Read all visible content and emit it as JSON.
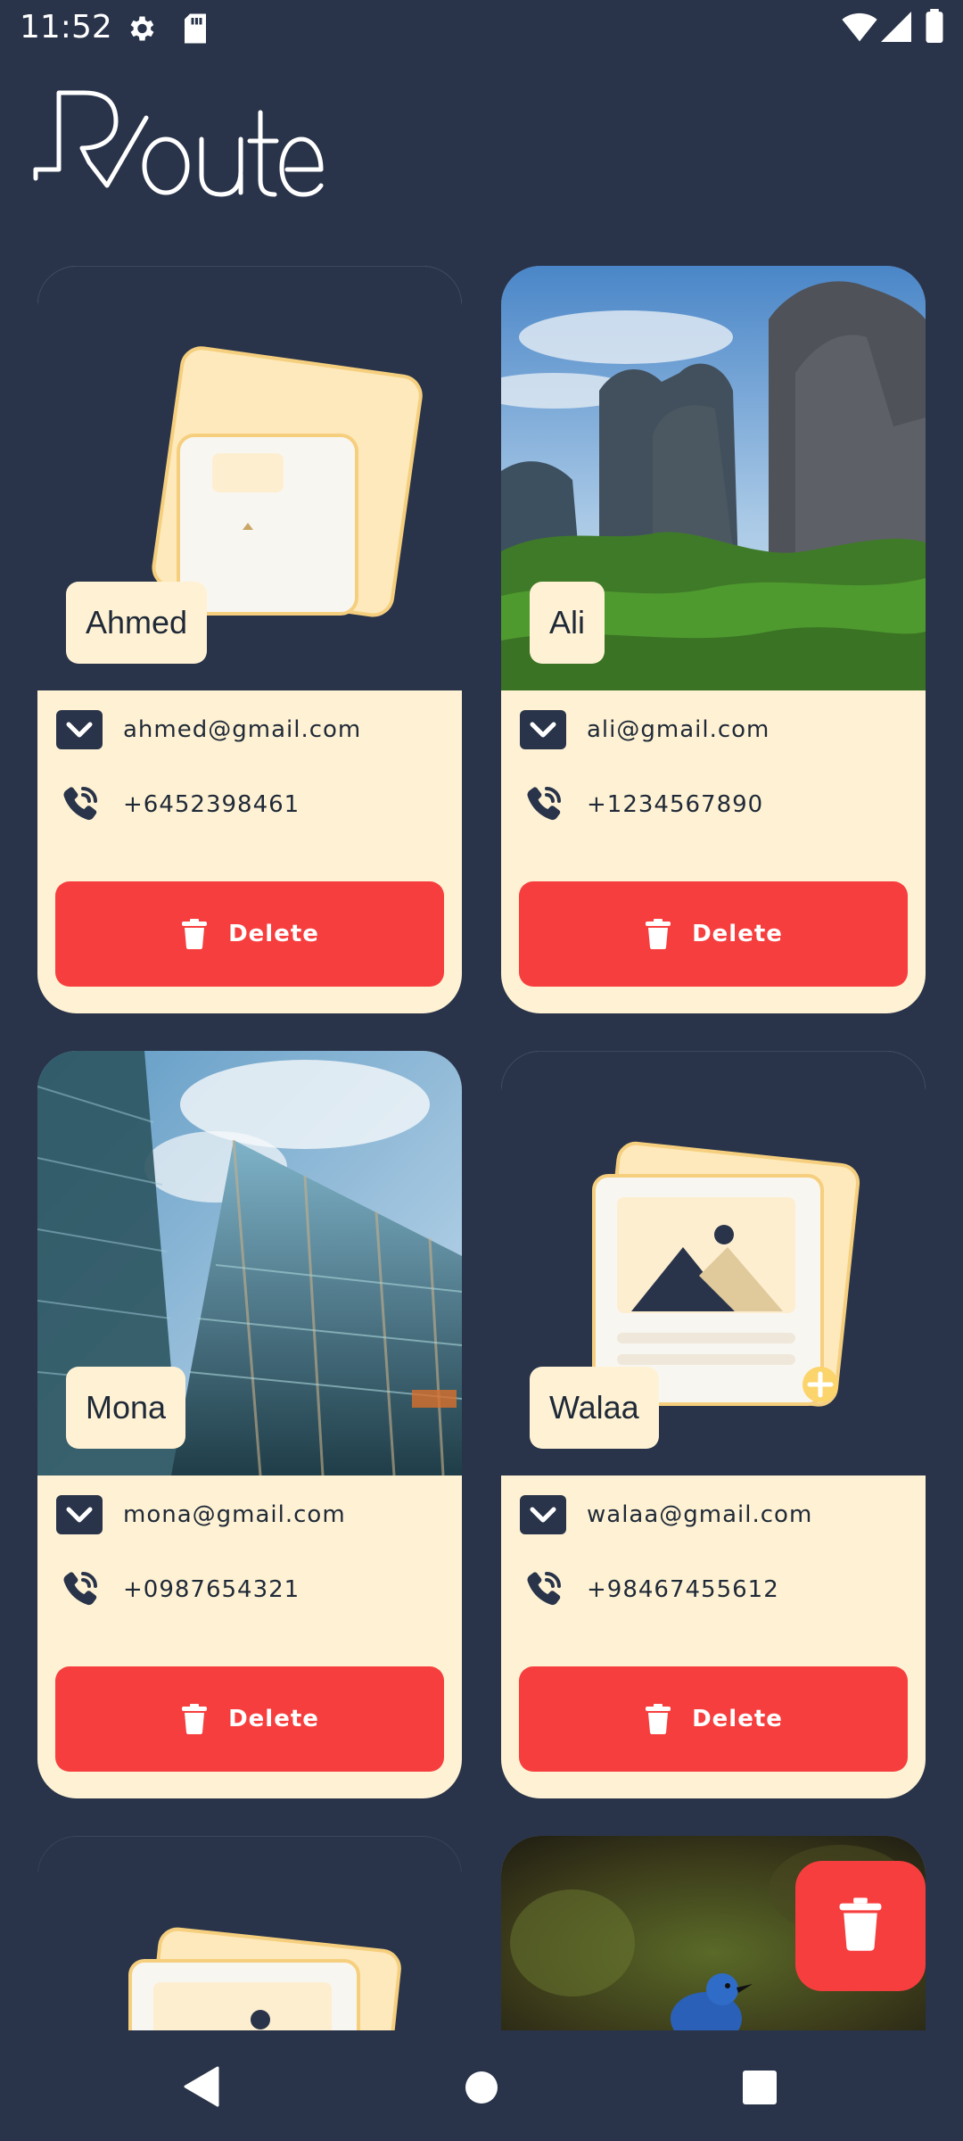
{
  "status_bar": {
    "time": "11:52"
  },
  "app": {
    "logo_text": "Route"
  },
  "contacts": [
    {
      "name": "Ahmed",
      "email": "ahmed@gmail.com",
      "phone": "+6452398461",
      "image": "placeholder"
    },
    {
      "name": "Ali",
      "email": "ali@gmail.com",
      "phone": "+1234567890",
      "image": "mountains"
    },
    {
      "name": "Mona",
      "email": "mona@gmail.com",
      "phone": "+0987654321",
      "image": "glass-building"
    },
    {
      "name": "Walaa",
      "email": "walaa@gmail.com",
      "phone": "+98467455612",
      "image": "placeholder"
    }
  ],
  "labels": {
    "delete": "Delete"
  },
  "colors": {
    "background": "#29344a",
    "card": "#fff2d4",
    "danger": "#f73e3e"
  },
  "icons": [
    "settings-icon",
    "sd-card-icon",
    "wifi-icon",
    "signal-icon",
    "battery-icon",
    "mail-icon",
    "phone-icon",
    "trash-icon",
    "back-icon",
    "home-icon",
    "recents-icon"
  ]
}
